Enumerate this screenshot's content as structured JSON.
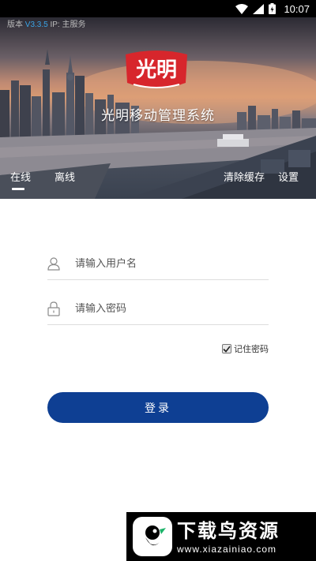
{
  "status_bar": {
    "time": "10:07",
    "icons": [
      "wifi-icon",
      "signal-icon",
      "battery-icon"
    ]
  },
  "banner": {
    "version_label": "版本",
    "version_value": "V3.3.5",
    "ip_text": "IP: 主服务",
    "logo_text": "光明",
    "title": "光明移动管理系统",
    "tabs": [
      {
        "label": "在线",
        "active": true
      },
      {
        "label": "离线",
        "active": false
      }
    ],
    "clear_cache_label": "清除缓存",
    "settings_label": "设置"
  },
  "form": {
    "username_placeholder": "请输入用户名",
    "password_placeholder": "请输入密码",
    "remember_label": "记住密码",
    "remember_checked": true,
    "login_label": "登录"
  },
  "watermark": {
    "title": "下载鸟资源",
    "url": "www.xiazainiao.com"
  },
  "colors": {
    "primary_button": "#0e3f93",
    "version_accent": "#3aa5e8",
    "logo_red": "#d7262c"
  }
}
